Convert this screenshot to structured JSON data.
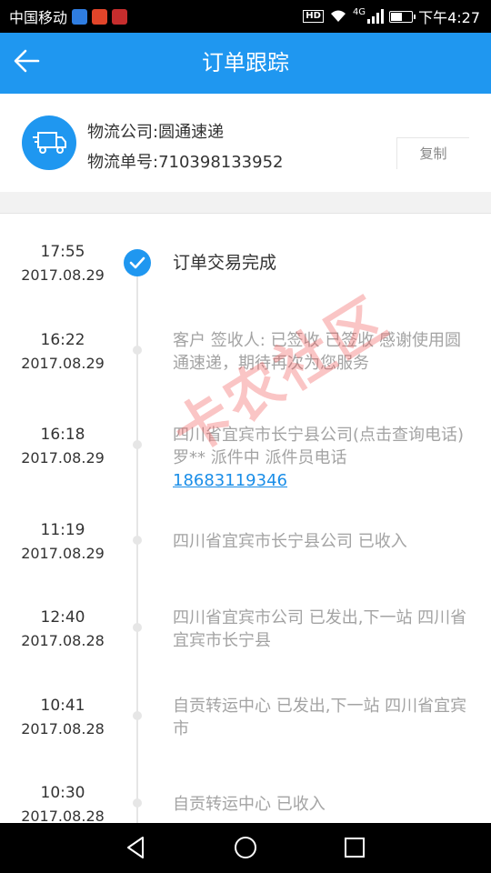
{
  "status_bar": {
    "carrier": "中国移动",
    "network": "4G",
    "hd": "HD",
    "time": "下午4:27",
    "battery_level": 0.6
  },
  "app_bar": {
    "title": "订单跟踪",
    "back_icon": "arrow-left-icon"
  },
  "company": {
    "icon": "truck-icon",
    "company_line": "物流公司:圆通速递",
    "number_line": "物流单号:710398133952",
    "copy_label": "复制"
  },
  "events": [
    {
      "time": "17:55",
      "date": "2017.08.29",
      "desc": "订单交易完成",
      "completed": true
    },
    {
      "time": "16:22",
      "date": "2017.08.29",
      "desc": "客户 签收人: 已签收 已签收  感谢使用圆通速递，期待再次为您服务"
    },
    {
      "time": "16:18",
      "date": "2017.08.29",
      "desc": "四川省宜宾市长宁县公司(点击查询电话)罗** 派件中 派件员电话",
      "phone": "18683119346"
    },
    {
      "time": "11:19",
      "date": "2017.08.29",
      "desc": "四川省宜宾市长宁县公司 已收入"
    },
    {
      "time": "12:40",
      "date": "2017.08.28",
      "desc": "四川省宜宾市公司 已发出,下一站 四川省宜宾市长宁县"
    },
    {
      "time": "10:41",
      "date": "2017.08.28",
      "desc": "自贡转运中心 已发出,下一站 四川省宜宾市"
    },
    {
      "time": "10:30",
      "date": "2017.08.28",
      "desc": "自贡转运中心 已收入"
    }
  ],
  "watermark": "卡农社区",
  "colors": {
    "accent": "#1f97f0",
    "link": "#1a8ee8",
    "muted_text": "#a3a3a3"
  },
  "nav": {
    "back_icon": "triangle-back-icon",
    "home_icon": "circle-home-icon",
    "recents_icon": "square-recents-icon"
  }
}
